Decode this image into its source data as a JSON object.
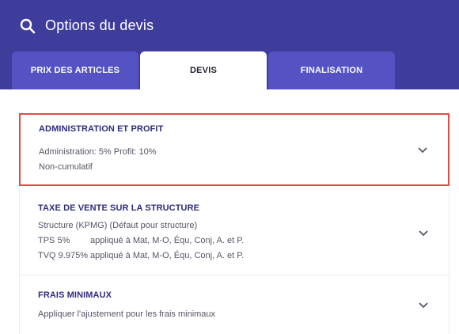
{
  "header": {
    "title": "Options du devis",
    "icon": "search-icon"
  },
  "tabs": [
    {
      "label": "PRIX DES ARTICLES",
      "active": false
    },
    {
      "label": "DEVIS",
      "active": true
    },
    {
      "label": "FINALISATION",
      "active": false
    }
  ],
  "sections": {
    "admin": {
      "title": "ADMINISTRATION ET PROFIT",
      "line1": "Administration:  5%  Profit:  10%",
      "line2": "Non-cumulatif"
    },
    "tax": {
      "title": "TAXE DE VENTE SUR LA STRUCTURE",
      "line1": "Structure (KPMG) (Défaut pour structure)",
      "rows": [
        {
          "name": "TPS 5%",
          "applies": "appliqué à Mat, M-O, Équ, Conj, A. et P."
        },
        {
          "name": "TVQ 9.975%",
          "applies": "appliqué à Mat, M-O, Équ, Conj, A. et P."
        }
      ]
    },
    "min": {
      "title": "FRAIS MINIMAUX",
      "line1": "Appliquer l'ajustement pour les frais minimaux"
    }
  },
  "colors": {
    "header_bg": "#3f3d9c",
    "tab_bg": "#5553c4",
    "highlight": "#e84a4a",
    "section_title": "#2e2c7c"
  }
}
